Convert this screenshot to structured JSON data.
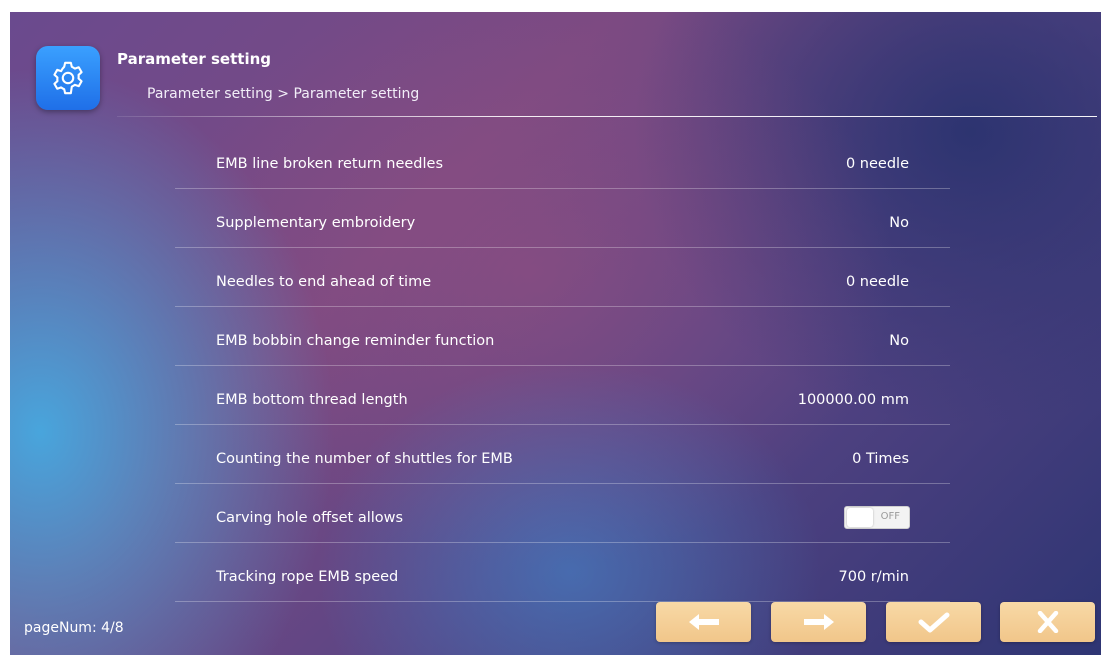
{
  "header": {
    "title": "Parameter setting",
    "breadcrumb": "Parameter setting > Parameter setting"
  },
  "params": [
    {
      "label": "EMB line broken return needles",
      "value": "0 needle"
    },
    {
      "label": "Supplementary embroidery",
      "value": "No"
    },
    {
      "label": "Needles to end ahead of time",
      "value": "0 needle"
    },
    {
      "label": "EMB bobbin change reminder function",
      "value": "No"
    },
    {
      "label": "EMB bottom thread length",
      "value": "100000.00 mm"
    },
    {
      "label": "Counting the number of shuttles for EMB",
      "value": "0 Times"
    },
    {
      "label": "Carving hole offset allows",
      "toggle": "OFF"
    },
    {
      "label": "Tracking rope EMB speed",
      "value": "700 r/min"
    }
  ],
  "footer": {
    "page_num": "pageNum: 4/8"
  },
  "buttons": {
    "prev_icon": "arrow-left-icon",
    "next_icon": "arrow-right-icon",
    "confirm_icon": "checkmark-icon",
    "close_icon": "close-icon"
  },
  "colors": {
    "app_icon": "#2c86f5",
    "nav_button": "#f4cd92"
  }
}
